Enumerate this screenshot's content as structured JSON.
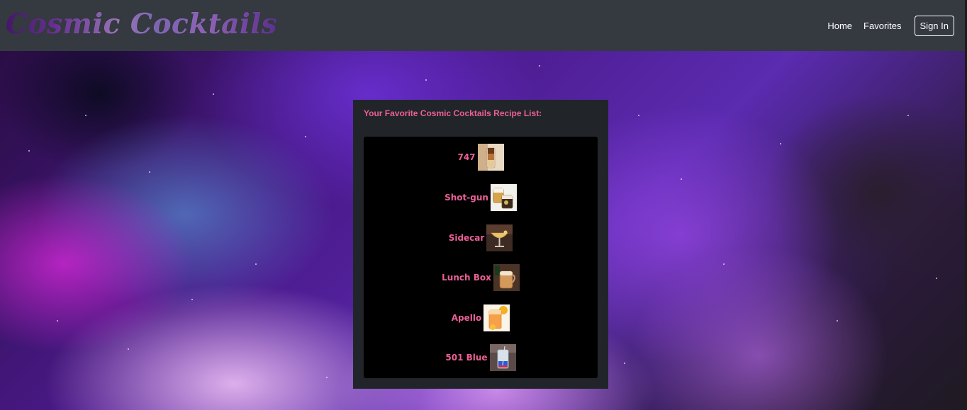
{
  "brand": {
    "title": "Cosmic Cocktails"
  },
  "nav": {
    "home_label": "Home",
    "favorites_label": "Favorites",
    "signin_label": "Sign In"
  },
  "panel": {
    "title": "Your Favorite Cosmic Cocktails Recipe List:"
  },
  "recipes": [
    {
      "name": "747",
      "thumb_icon": "layered-shot-glass-thumbnail"
    },
    {
      "name": "Shot-gun",
      "thumb_icon": "whiskey-tumblers-thumbnail"
    },
    {
      "name": "Sidecar",
      "thumb_icon": "coupe-glass-thumbnail"
    },
    {
      "name": "Lunch Box",
      "thumb_icon": "beer-mug-thumbnail"
    },
    {
      "name": "Apello",
      "thumb_icon": "orange-drink-thumbnail"
    },
    {
      "name": "501 Blue",
      "thumb_icon": "blue-layered-glass-thumbnail"
    }
  ],
  "colors": {
    "navbar": "#343a40",
    "panel": "#212529",
    "accent_pink": "#ea5f96",
    "list_bg": "#000000"
  }
}
